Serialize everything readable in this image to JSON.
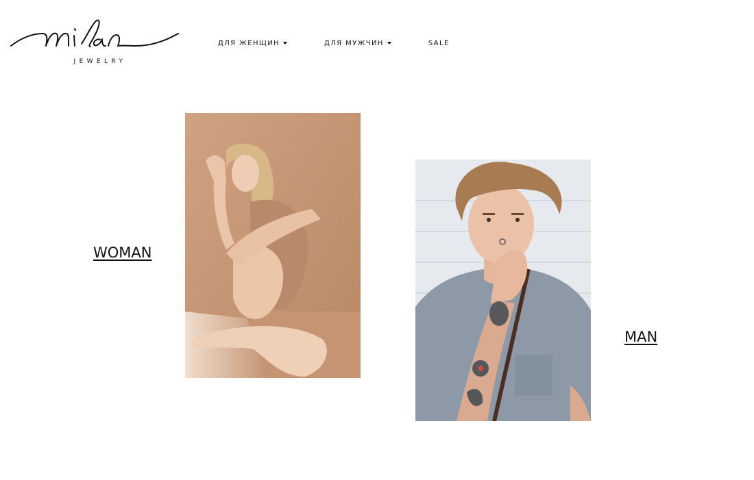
{
  "header": {
    "logo_text": "mi lan",
    "logo_subtitle": "JEWELRY",
    "nav": [
      {
        "label": "ДЛЯ ЖЕНЩИН",
        "has_dropdown": true
      },
      {
        "label": "ДЛЯ МУЖЧИН",
        "has_dropdown": true
      },
      {
        "label": "SALE",
        "has_dropdown": false
      }
    ]
  },
  "categories": {
    "woman": {
      "label": "WOMAN"
    },
    "man": {
      "label": "MAN"
    }
  },
  "colors": {
    "background": "#ffffff",
    "text": "#111111",
    "woman_photo_bg": "#c99c7a",
    "man_photo_bg": "#e8ecf0",
    "man_shirt": "#8d99a7"
  }
}
